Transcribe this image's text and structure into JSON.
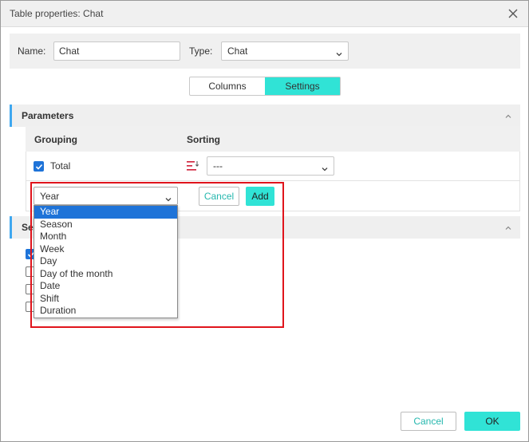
{
  "window": {
    "title": "Table properties: Chat"
  },
  "form": {
    "name_label": "Name:",
    "name_value": "Chat",
    "type_label": "Type:",
    "type_value": "Chat"
  },
  "tabs": [
    {
      "label": "Columns",
      "active": false
    },
    {
      "label": "Settings",
      "active": true
    }
  ],
  "parameters": {
    "title": "Parameters",
    "grouping_header": "Grouping",
    "sorting_header": "Sorting",
    "row": {
      "checked": true,
      "label": "Total",
      "sort_value": "---"
    },
    "new_row": {
      "select_value": "Year",
      "cancel_label": "Cancel",
      "add_label": "Add"
    },
    "dropdown_options": [
      "Year",
      "Season",
      "Month",
      "Week",
      "Day",
      "Day of the month",
      "Date",
      "Shift",
      "Duration"
    ],
    "selected_option": "Year"
  },
  "second_section": {
    "title_visible": "Se",
    "checkboxes": [
      {
        "checked": true
      },
      {
        "checked": false
      },
      {
        "checked": false
      },
      {
        "checked": false
      }
    ]
  },
  "footer": {
    "cancel_label": "Cancel",
    "ok_label": "OK"
  },
  "colors": {
    "accent": "#30e3d6",
    "link": "#25b7ae",
    "section_bar": "#3ea8f0",
    "checkbox": "#1e73d8",
    "highlight_box": "#e0141c",
    "sort_icon": "#d0203a"
  }
}
